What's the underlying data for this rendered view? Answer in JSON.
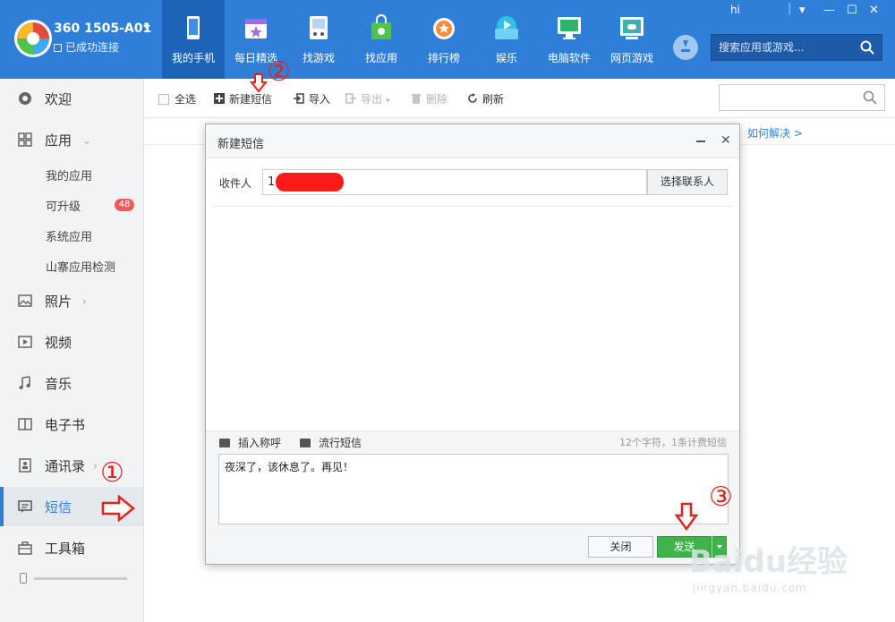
{
  "device": {
    "name": "360 1505-A01",
    "status": "已成功连接"
  },
  "nav": {
    "tabs": [
      {
        "label": "我的手机",
        "icon": "phone-icon",
        "color": "#ffffff"
      },
      {
        "label": "每日精选",
        "icon": "calendar-star-icon",
        "color": "#a36be0"
      },
      {
        "label": "找游戏",
        "icon": "gamepad-icon",
        "color": "#ffffff"
      },
      {
        "label": "找应用",
        "icon": "shopping-bag-icon",
        "color": "#4fc34a"
      },
      {
        "label": "排行榜",
        "icon": "medal-icon",
        "color": "#ff8c3a"
      },
      {
        "label": "娱乐",
        "icon": "play-icon",
        "color": "#2fc0e8"
      },
      {
        "label": "电脑软件",
        "icon": "monitor-icon",
        "color": "#2fb36a"
      },
      {
        "label": "网页游戏",
        "icon": "web-game-icon",
        "color": "#3fb0a6"
      }
    ],
    "active_index": 0
  },
  "window": {
    "user": "hi"
  },
  "app_search": {
    "placeholder": "搜索应用或游戏..."
  },
  "sidebar": {
    "items": [
      {
        "label": "欢迎",
        "icon": "welcome-icon"
      },
      {
        "label": "应用",
        "icon": "apps-grid-icon"
      },
      {
        "label": "照片",
        "icon": "photo-icon"
      },
      {
        "label": "视频",
        "icon": "video-icon"
      },
      {
        "label": "音乐",
        "icon": "music-icon"
      },
      {
        "label": "电子书",
        "icon": "ebook-icon"
      },
      {
        "label": "通讯录",
        "icon": "contacts-icon"
      },
      {
        "label": "短信",
        "icon": "sms-icon"
      },
      {
        "label": "工具箱",
        "icon": "toolbox-icon"
      }
    ],
    "app_sub": [
      "我的应用",
      "可升级",
      "系统应用",
      "山寨应用检测"
    ],
    "upgrade_badge": "48",
    "active_index": 7
  },
  "toolbar": {
    "select_all": "全选",
    "new_sms": "新建短信",
    "import": "导入",
    "export": "导出",
    "delete": "删除",
    "refresh": "刷新"
  },
  "hint": {
    "link": "如何解决 >"
  },
  "dialog": {
    "title": "新建短信",
    "to_label": "收件人",
    "to_value": "1",
    "pick_contacts": "选择联系人",
    "insert_name": "插入称呼",
    "popular_sms": "流行短信",
    "char_count": "12个字符，1条计费短信",
    "message": "夜深了，该休息了。再见！",
    "close": "关闭",
    "send": "发送"
  },
  "annotations": {
    "step1": "①",
    "step2": "②",
    "step3": "③"
  },
  "watermark": {
    "text": "Baidu经验",
    "url": "jingyan.baidu.com"
  },
  "colors": {
    "header": "#2f7fd9",
    "active_tab": "#1d63b8",
    "send": "#3fb24a",
    "annotation": "#e0241b"
  }
}
